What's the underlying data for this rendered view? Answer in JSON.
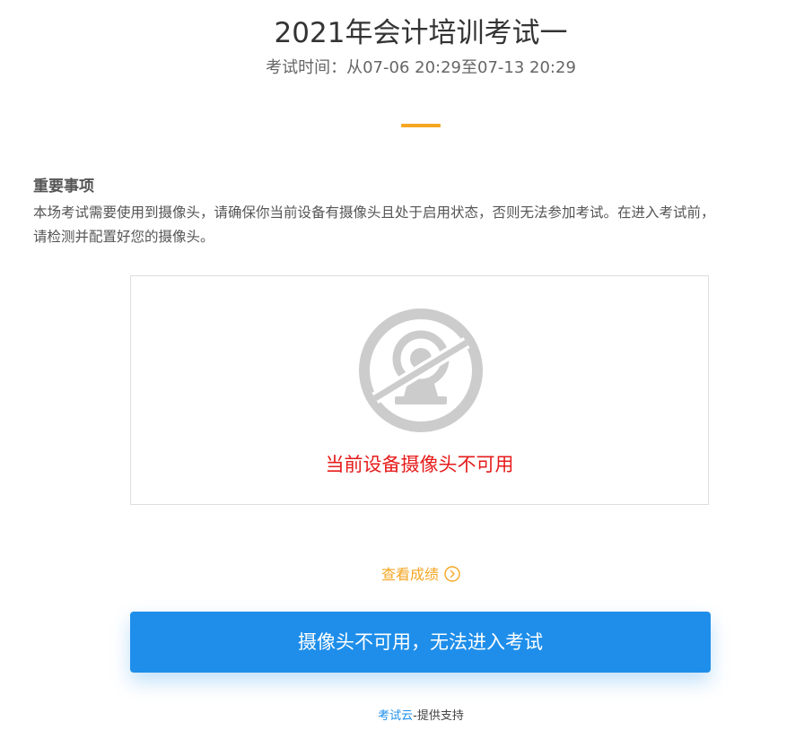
{
  "header": {
    "title": "2021年会计培训考试一",
    "time_text": "考试时间：从07-06 20:29至07-13 20:29"
  },
  "notice": {
    "title": "重要事项",
    "line1": "本场考试需要使用到摄像头，请确保你当前设备有摄像头且处于启用状态，否则无法参加考试。在进入考试前，",
    "line2": "请检测并配置好您的摄像头。"
  },
  "camera": {
    "icon": "camera-disabled-icon",
    "error_text": "当前设备摄像头不可用"
  },
  "results_link": {
    "label": "查看成绩",
    "icon": "chevron-right-circle-icon"
  },
  "enter_button": {
    "label": "摄像头不可用，无法进入考试"
  },
  "footer": {
    "brand": "考试云",
    "suffix": "-提供支持"
  },
  "colors": {
    "accent": "#f5a623",
    "primary": "#1e8eea",
    "error": "#e61b1b",
    "icon_gray": "#cccccc"
  }
}
